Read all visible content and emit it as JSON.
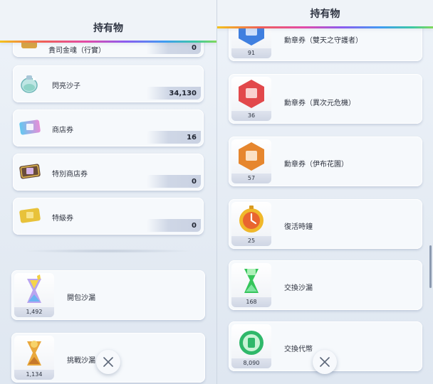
{
  "left": {
    "title": "持有物",
    "items": [
      {
        "name": "貴司金魂（行實）",
        "count": "0"
      },
      {
        "name": "閃亮沙子",
        "count": "34,130"
      },
      {
        "name": "商店券",
        "count": "16"
      },
      {
        "name": "特別商店券",
        "count": "0"
      },
      {
        "name": "特級券",
        "count": "0"
      }
    ],
    "big_items": [
      {
        "name": "開包沙漏",
        "count": "1,492"
      },
      {
        "name": "挑戰沙漏",
        "count": "1,134"
      }
    ]
  },
  "right": {
    "title": "持有物",
    "items": [
      {
        "name": "勳章券（雙天之守護者）",
        "count": "91"
      },
      {
        "name": "勳章券（異次元危機）",
        "count": "36"
      },
      {
        "name": "勳章券（伊布花園）",
        "count": "57"
      },
      {
        "name": "復活時鐘",
        "count": "25"
      },
      {
        "name": "交換沙漏",
        "count": "168"
      },
      {
        "name": "交換代幣",
        "count": "8,090"
      }
    ]
  },
  "icons": {
    "close": "close-icon",
    "colors": {
      "accent_text": "#2e3442",
      "medal_blue": "#3f7fe0",
      "medal_red": "#e2484b",
      "medal_orange": "#e6862e",
      "clock_gold": "#f0b82a",
      "hourglass_green": "#35c55a",
      "coin_green": "#2fb86a"
    }
  }
}
